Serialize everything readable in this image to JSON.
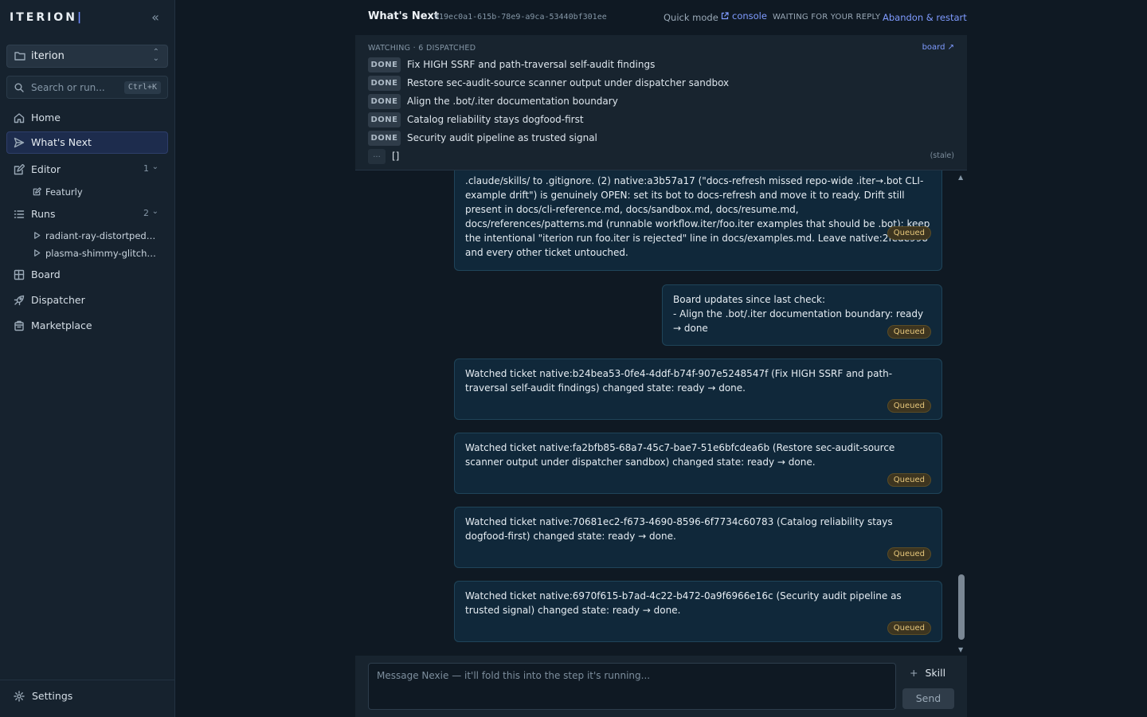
{
  "sidebar": {
    "brand": "ITERION",
    "project": "iterion",
    "search_placeholder": "Search or run...",
    "search_shortcut": "Ctrl+K",
    "nav": [
      {
        "label": "Home"
      },
      {
        "label": "What's Next"
      },
      {
        "label": "Editor",
        "count": "1"
      },
      {
        "label": "Runs",
        "count": "2"
      },
      {
        "label": "Board"
      },
      {
        "label": "Dispatcher"
      },
      {
        "label": "Marketplace"
      }
    ],
    "editor_items": [
      "Featurly"
    ],
    "run_items": [
      "radiant-ray-distortpedal...",
      "plasma-shimmy-glitchf..."
    ],
    "settings": "Settings"
  },
  "header": {
    "title": "What's Next",
    "run_id": "019ec0a1-615b-78e9-a9ca-53440bf301ee",
    "quick_mode": "Quick mode",
    "console": "console",
    "status": "WAITING FOR YOUR REPLY",
    "abandon": "Abandon & restart"
  },
  "watching": {
    "label": "WATCHING · 6 DISPATCHED",
    "board_link": "board ↗",
    "items": [
      {
        "state": "DONE",
        "title": "Fix HIGH SSRF and path-traversal self-audit findings"
      },
      {
        "state": "DONE",
        "title": "Restore sec-audit-source scanner output under dispatcher sandbox"
      },
      {
        "state": "DONE",
        "title": "Align the .bot/.iter documentation boundary"
      },
      {
        "state": "DONE",
        "title": "Catalog reliability stays dogfood-first"
      },
      {
        "state": "DONE",
        "title": "Security audit pipeline as trusted signal"
      }
    ],
    "more": "...",
    "empty_brackets": "[]",
    "stale": "(stale)"
  },
  "messages": [
    {
      "text": ".claude/skills/ to .gitignore. (2) native:a3b57a17 (\"docs-refresh missed repo-wide .iter→.bot CLI-example drift\") is genuinely OPEN: set its bot to docs-refresh and move it to ready. Drift still present in docs/cli-reference.md, docs/sandbox.md, docs/resume.md, docs/references/patterns.md (runnable workflow.iter/foo.iter examples that should be .bot); keep the intentional \"iterion run foo.iter is rejected\" line in docs/examples.md. Leave native:2fede998 and every other ticket untouched.",
      "status": "Queued"
    },
    {
      "text": "Board updates since last check:\n- Align the .bot/.iter documentation boundary: ready → done",
      "status": "Queued"
    },
    {
      "text": "Watched ticket native:b24bea53-0fe4-4ddf-b74f-907e5248547f (Fix HIGH SSRF and path-traversal self-audit findings) changed state: ready → done.",
      "status": "Queued"
    },
    {
      "text": "Watched ticket native:fa2bfb85-68a7-45c7-bae7-51e6bfcdea6b (Restore sec-audit-source scanner output under dispatcher sandbox) changed state: ready → done.",
      "status": "Queued"
    },
    {
      "text": "Watched ticket native:70681ec2-f673-4690-8596-6f7734c60783 (Catalog reliability stays dogfood-first) changed state: ready → done.",
      "status": "Queued"
    },
    {
      "text": "Watched ticket native:6970f615-b7ad-4c22-b472-0a9f6966e16c (Security audit pipeline as trusted signal) changed state: ready → done.",
      "status": "Queued"
    }
  ],
  "composer": {
    "placeholder": "Message Nexie — it'll fold this into the step it's running...",
    "skill": "Skill",
    "send": "Send"
  }
}
